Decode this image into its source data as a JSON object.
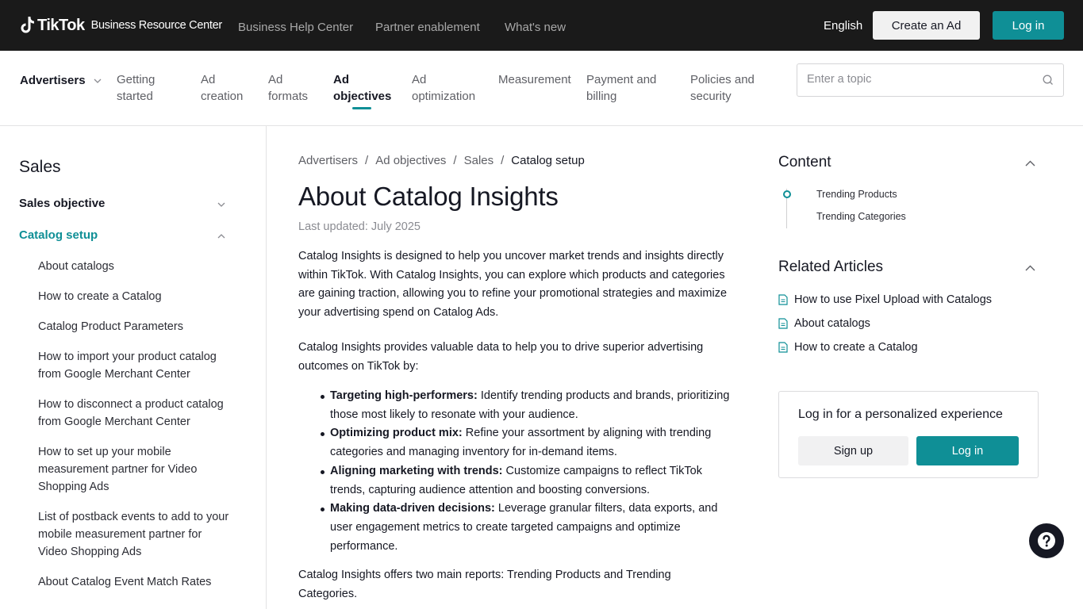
{
  "header": {
    "logo_text": "TikTok",
    "logo_sub": "Business Resource Center",
    "nav": [
      "Business Help Center",
      "Partner enablement",
      "What's new"
    ],
    "language": "English",
    "create_ad": "Create an Ad",
    "login": "Log in"
  },
  "subnav": {
    "audience": "Advertisers",
    "items": [
      {
        "line1": "Getting",
        "line2": "started"
      },
      {
        "line1": "Ad",
        "line2": "creation"
      },
      {
        "line1": "Ad",
        "line2": "formats"
      },
      {
        "line1": "Ad",
        "line2": "objectives"
      },
      {
        "line1": "Ad",
        "line2": "optimization"
      },
      {
        "line1": "Measurement",
        "line2": ""
      },
      {
        "line1": "Payment and",
        "line2": "billing"
      },
      {
        "line1": "Policies and",
        "line2": "security"
      }
    ],
    "search_placeholder": "Enter a topic"
  },
  "sidebar": {
    "title": "Sales",
    "groups": [
      "Sales objective",
      "Catalog setup"
    ],
    "links": [
      "About catalogs",
      "How to create a Catalog",
      "Catalog Product Parameters",
      "How to import your product catalog from Google Merchant Center",
      "How to disconnect a product catalog from Google Merchant Center",
      "How to set up your mobile measurement partner for Video Shopping Ads",
      "List of postback events to add to your mobile measurement partner for Video Shopping Ads",
      "About Catalog Event Match Rates"
    ]
  },
  "article": {
    "breadcrumbs": [
      "Advertisers",
      "/",
      "Ad objectives",
      "/",
      "Sales",
      "/",
      "Catalog setup"
    ],
    "title": "About Catalog Insights",
    "updated": "Last updated: July 2025",
    "p1": "Catalog Insights is designed to help you uncover market trends and insights directly within TikTok. With Catalog Insights, you can explore which products and categories are gaining traction, allowing you to refine your promotional strategies and maximize your advertising spend on Catalog Ads.",
    "p2": "Catalog Insights provides valuable data to help you to drive superior advertising outcomes on TikTok by:",
    "bullets": [
      {
        "bold": "Targeting high-performers:",
        "text": " Identify trending products and brands, prioritizing those most likely to resonate with your audience."
      },
      {
        "bold": "Optimizing product mix:",
        "text": " Refine your assortment by aligning with trending categories and managing inventory for in-demand items."
      },
      {
        "bold": "Aligning marketing with trends:",
        "text": " Customize campaigns to reflect TikTok trends, capturing audience attention and boosting conversions."
      },
      {
        "bold": "Making data-driven decisions:",
        "text": " Leverage granular filters, data exports, and user engagement metrics to create targeted campaigns and optimize performance."
      }
    ],
    "p3": "Catalog Insights offers two main reports: Trending Products and Trending Categories."
  },
  "right": {
    "content_title": "Content",
    "toc": [
      "Trending Products",
      "Trending Categories"
    ],
    "related_title": "Related Articles",
    "related": [
      "How to use Pixel Upload with Catalogs",
      "About catalogs",
      "How to create a Catalog"
    ],
    "login_card_title": "Log in for a personalized experience",
    "signup": "Sign up",
    "login": "Log in"
  },
  "colors": {
    "accent": "#0f8f96",
    "topbar": "#1a1a1a"
  }
}
